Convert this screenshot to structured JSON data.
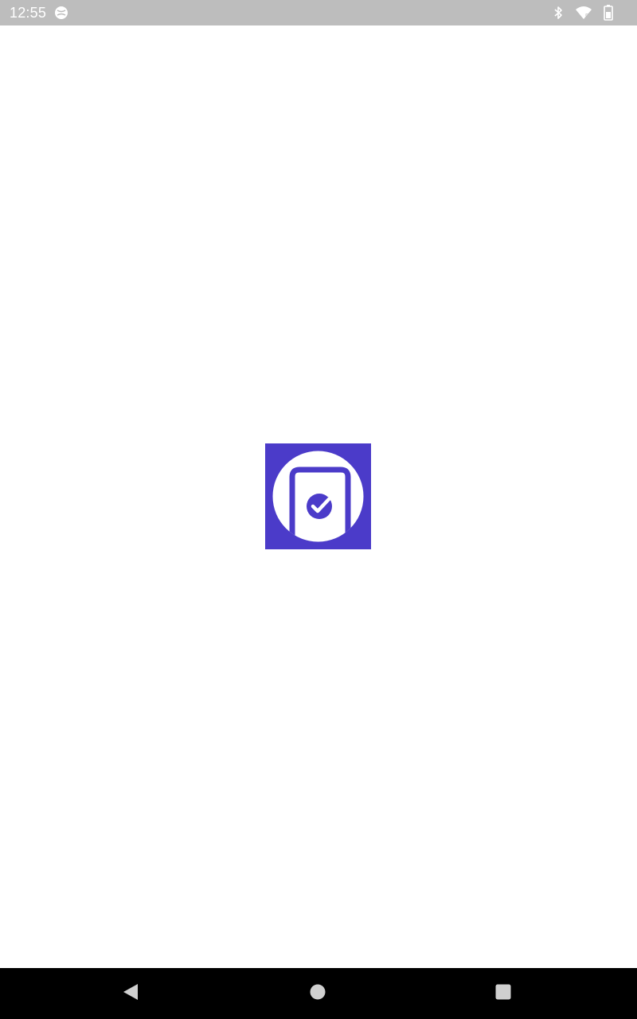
{
  "status_bar": {
    "time": "12:55",
    "icons": [
      "sync-icon",
      "bluetooth-icon",
      "wifi-icon",
      "battery-icon"
    ],
    "background": "#bdbdbd"
  },
  "splash": {
    "logo_icon": "app-logo-icon",
    "brand_color": "#4b3bc9"
  },
  "nav_bar": {
    "buttons": [
      "back-icon",
      "home-icon",
      "recents-icon"
    ],
    "background": "#000000"
  }
}
